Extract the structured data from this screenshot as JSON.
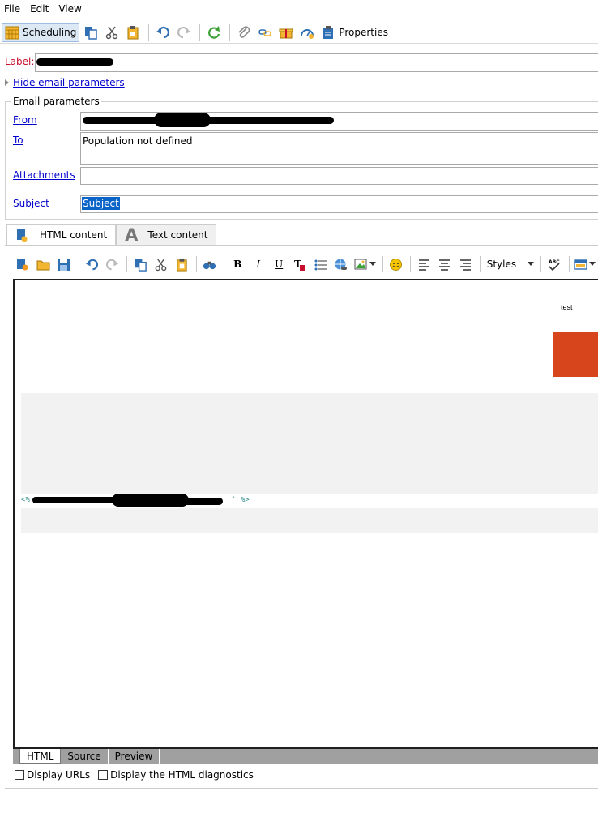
{
  "menu": [
    "File",
    "Edit",
    "View"
  ],
  "toolbar": {
    "scheduling": "Scheduling",
    "properties": "Properties"
  },
  "form": {
    "label_caption": "Label:",
    "hide_params": "Hide email parameters",
    "group_title": "Email parameters",
    "from_label": "From",
    "to_label": "To",
    "to_value": "Population not defined",
    "attachments_label": "Attachments",
    "subject_label": "Subject",
    "subject_value": "Subject"
  },
  "tabs": {
    "html": "HTML content",
    "text": "Text content"
  },
  "editor_toolbar": {
    "styles": "Styles"
  },
  "editor": {
    "test_text": "test",
    "code_open": "<%",
    "code_close": "' %>",
    "accent_color": "#d6451b",
    "panel_color": "#f2f2f2"
  },
  "bottom_tabs": [
    "HTML",
    "Source",
    "Preview"
  ],
  "checks": {
    "display_urls": "Display URLs",
    "html_diagnostics": "Display the HTML diagnostics"
  }
}
